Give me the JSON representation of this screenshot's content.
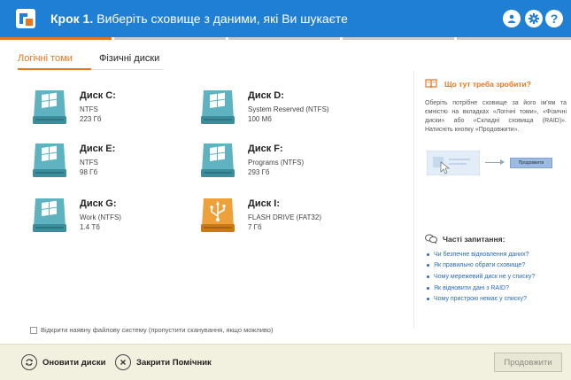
{
  "header": {
    "step_label": "Крок 1.",
    "title": "Виберіть сховище з даними, які Ви шукаєте",
    "icons": [
      "user-icon",
      "gear-icon",
      "help-icon"
    ],
    "help_glyph": "?"
  },
  "colors": {
    "header_bg": "#1f7fd4",
    "accent": "#e8761e",
    "link": "#2a6bb8",
    "footer_bg": "#f2f0df",
    "disk_teal": "#4a9fad",
    "disk_orange": "#e8901c"
  },
  "steps": {
    "total": 5,
    "active": 1
  },
  "tabs": [
    {
      "label": "Логічні томи",
      "active": true
    },
    {
      "label": "Фізичні диски",
      "active": false
    }
  ],
  "disks": [
    {
      "name": "Диск C:",
      "fs": "NTFS",
      "size": "223 Гб",
      "type": "windows"
    },
    {
      "name": "Диск D:",
      "fs": "System Reserved (NTFS)",
      "size": "100 Мб",
      "type": "windows"
    },
    {
      "name": "Диск E:",
      "fs": "NTFS",
      "size": "98 Гб",
      "type": "windows"
    },
    {
      "name": "Диск F:",
      "fs": "Programs (NTFS)",
      "size": "293 Гб",
      "type": "windows"
    },
    {
      "name": "Диск G:",
      "fs": "Work (NTFS)",
      "size": "1.4 Тб",
      "type": "windows"
    },
    {
      "name": "Диск I:",
      "fs": "FLASH DRIVE (FAT32)",
      "size": "7 Гб",
      "type": "usb"
    }
  ],
  "open_fs_checkbox": {
    "label": "Відкрити наявну файлову систему (пропустити сканування, якщо можливо)",
    "checked": false
  },
  "help": {
    "title": "Що тут треба зробити?",
    "text": "Оберіть потрібне сховище за його ім'ям та ємністю на вкладках «Логічні томи», «Фізичні диски» або «Складні сховища (RAID)». Натисніть кнопку «Продовжити».",
    "illustration_button": "Продовжити"
  },
  "faq": {
    "title": "Часті запитання:",
    "items": [
      "Чи безпечне відновлення даних?",
      "Як правильно обрати сховище?",
      "Чому мережевий диск не у списку?",
      "Як відновити дані з RAID?",
      "Чому пристрою немає у списку?"
    ]
  },
  "footer": {
    "refresh_label": "Оновити диски",
    "close_label": "Закрити Помічник",
    "next_label": "Продовжити"
  }
}
